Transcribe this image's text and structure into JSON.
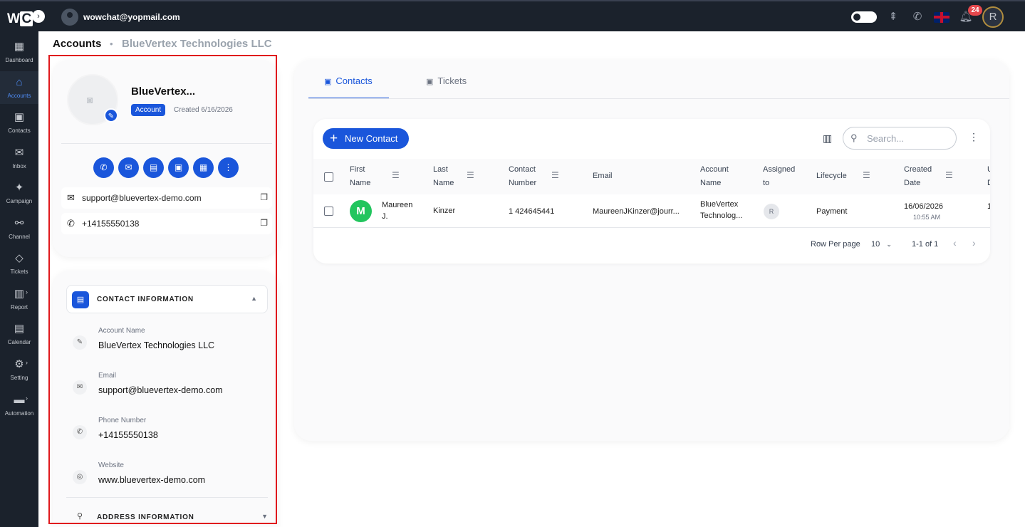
{
  "topbar": {
    "logo": "WC",
    "user_email": "wowchat@yopmail.com",
    "notification_count": "24",
    "profile_initial": "R"
  },
  "sidebar": {
    "items": [
      {
        "label": "Dashboard",
        "icon": "dashboard-icon"
      },
      {
        "label": "Accounts",
        "icon": "home-icon"
      },
      {
        "label": "Contacts",
        "icon": "contacts-icon"
      },
      {
        "label": "Inbox",
        "icon": "inbox-icon"
      },
      {
        "label": "Campaign",
        "icon": "campaign-icon"
      },
      {
        "label": "Channel",
        "icon": "channel-icon"
      },
      {
        "label": "Tickets",
        "icon": "ticket-icon"
      },
      {
        "label": "Report",
        "icon": "report-icon"
      },
      {
        "label": "Calendar",
        "icon": "calendar-icon"
      },
      {
        "label": "Setting",
        "icon": "gear-icon"
      },
      {
        "label": "Automation",
        "icon": "automation-icon"
      }
    ]
  },
  "breadcrumb": {
    "main": "Accounts",
    "separator": "•",
    "sub": "BlueVertex Technologies LLC"
  },
  "account_card": {
    "name": "BlueVertex...",
    "badge": "Account",
    "created": "Created 6/16/2026",
    "email": "support@bluevertex-demo.com",
    "phone": "+14155550138"
  },
  "contact_info": {
    "title": "CONTACT INFORMATION",
    "fields": [
      {
        "label": "Account Name",
        "value": "BlueVertex Technologies LLC"
      },
      {
        "label": "Email",
        "value": "support@bluevertex-demo.com"
      },
      {
        "label": "Phone Number",
        "value": "+14155550138"
      },
      {
        "label": "Website",
        "value": "www.bluevertex-demo.com"
      }
    ],
    "address_title": "ADDRESS INFORMATION"
  },
  "tabs": [
    {
      "label": "Contacts",
      "active": true
    },
    {
      "label": "Tickets",
      "active": false
    }
  ],
  "contacts_table": {
    "new_button": "New Contact",
    "search_placeholder": "Search...",
    "headers": {
      "first_name": [
        "First",
        "Name"
      ],
      "last_name": [
        "Last",
        "Name"
      ],
      "contact_number": [
        "Contact",
        "Number"
      ],
      "email": "Email",
      "account_name": [
        "Account",
        "Name"
      ],
      "assigned_to": [
        "Assigned",
        "to"
      ],
      "lifecycle": "Lifecycle",
      "created_date": [
        "Created",
        "Date"
      ],
      "updated_date": [
        "U",
        "D"
      ]
    },
    "rows": [
      {
        "avatar": "M",
        "first_name": [
          "Maureen",
          "J."
        ],
        "last_name": "Kinzer",
        "contact_number": "1 424645441",
        "email": "MaureenJKinzer@jourr...",
        "account_name": [
          "BlueVertex",
          "Technolog..."
        ],
        "assigned": "R",
        "lifecycle": "Payment",
        "created_date": "16/06/2026",
        "created_time": "10:55 AM",
        "updated": "1"
      }
    ],
    "pagination": {
      "rows_per_page_label": "Row Per page",
      "rows_per_page": "10",
      "range": "1-1 of 1"
    }
  },
  "colors": {
    "accent": "#1a56db",
    "sidebar_bg": "#1b222c",
    "highlight_outline": "#e0191d"
  }
}
